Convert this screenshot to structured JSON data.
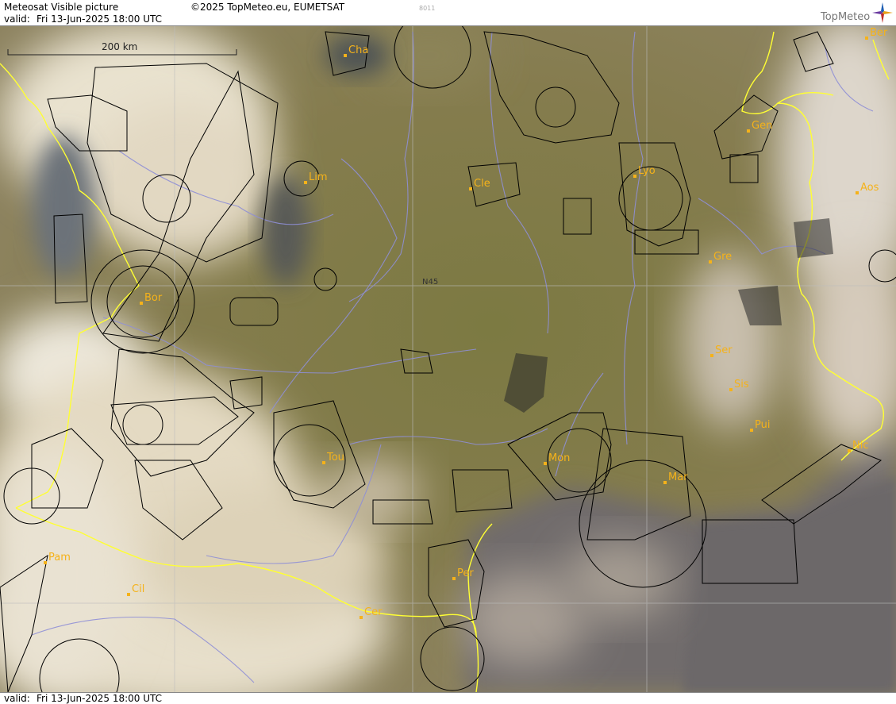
{
  "header": {
    "title": "Meteosat Visible picture",
    "copyright": "©2025 TopMeteo.eu, EUMETSAT",
    "code": "8011",
    "valid_label": "valid:",
    "valid_date": "Fri  13-Jun-2025  18:00 UTC",
    "brand": "TopMeteo"
  },
  "footer": {
    "valid_label": "valid:",
    "valid_date": "Fri  13-Jun-2025  18:00 UTC"
  },
  "map": {
    "scale_label": "200 km",
    "grid_label": "N45",
    "colors": {
      "border": "#ffff33",
      "river": "#8f8fd6",
      "airspace": "#000000",
      "city": "#f5b21a"
    },
    "cities": [
      {
        "id": "cha",
        "label": "Cha"
      },
      {
        "id": "ber",
        "label": "Ber"
      },
      {
        "id": "gen",
        "label": "Gen"
      },
      {
        "id": "lim",
        "label": "Lim"
      },
      {
        "id": "cle",
        "label": "Cle"
      },
      {
        "id": "lyo",
        "label": "Lyo"
      },
      {
        "id": "aos",
        "label": "Aos"
      },
      {
        "id": "gre",
        "label": "Gre"
      },
      {
        "id": "bor",
        "label": "Bor"
      },
      {
        "id": "ser",
        "label": "Ser"
      },
      {
        "id": "sis",
        "label": "Sis"
      },
      {
        "id": "pui",
        "label": "Pui"
      },
      {
        "id": "tou",
        "label": "Tou"
      },
      {
        "id": "mon",
        "label": "Mon"
      },
      {
        "id": "mar",
        "label": "Mar"
      },
      {
        "id": "nic",
        "label": "Nic"
      },
      {
        "id": "pam",
        "label": "Pam"
      },
      {
        "id": "cil",
        "label": "Cil"
      },
      {
        "id": "per",
        "label": "Per"
      },
      {
        "id": "cer",
        "label": "Cer"
      }
    ]
  }
}
